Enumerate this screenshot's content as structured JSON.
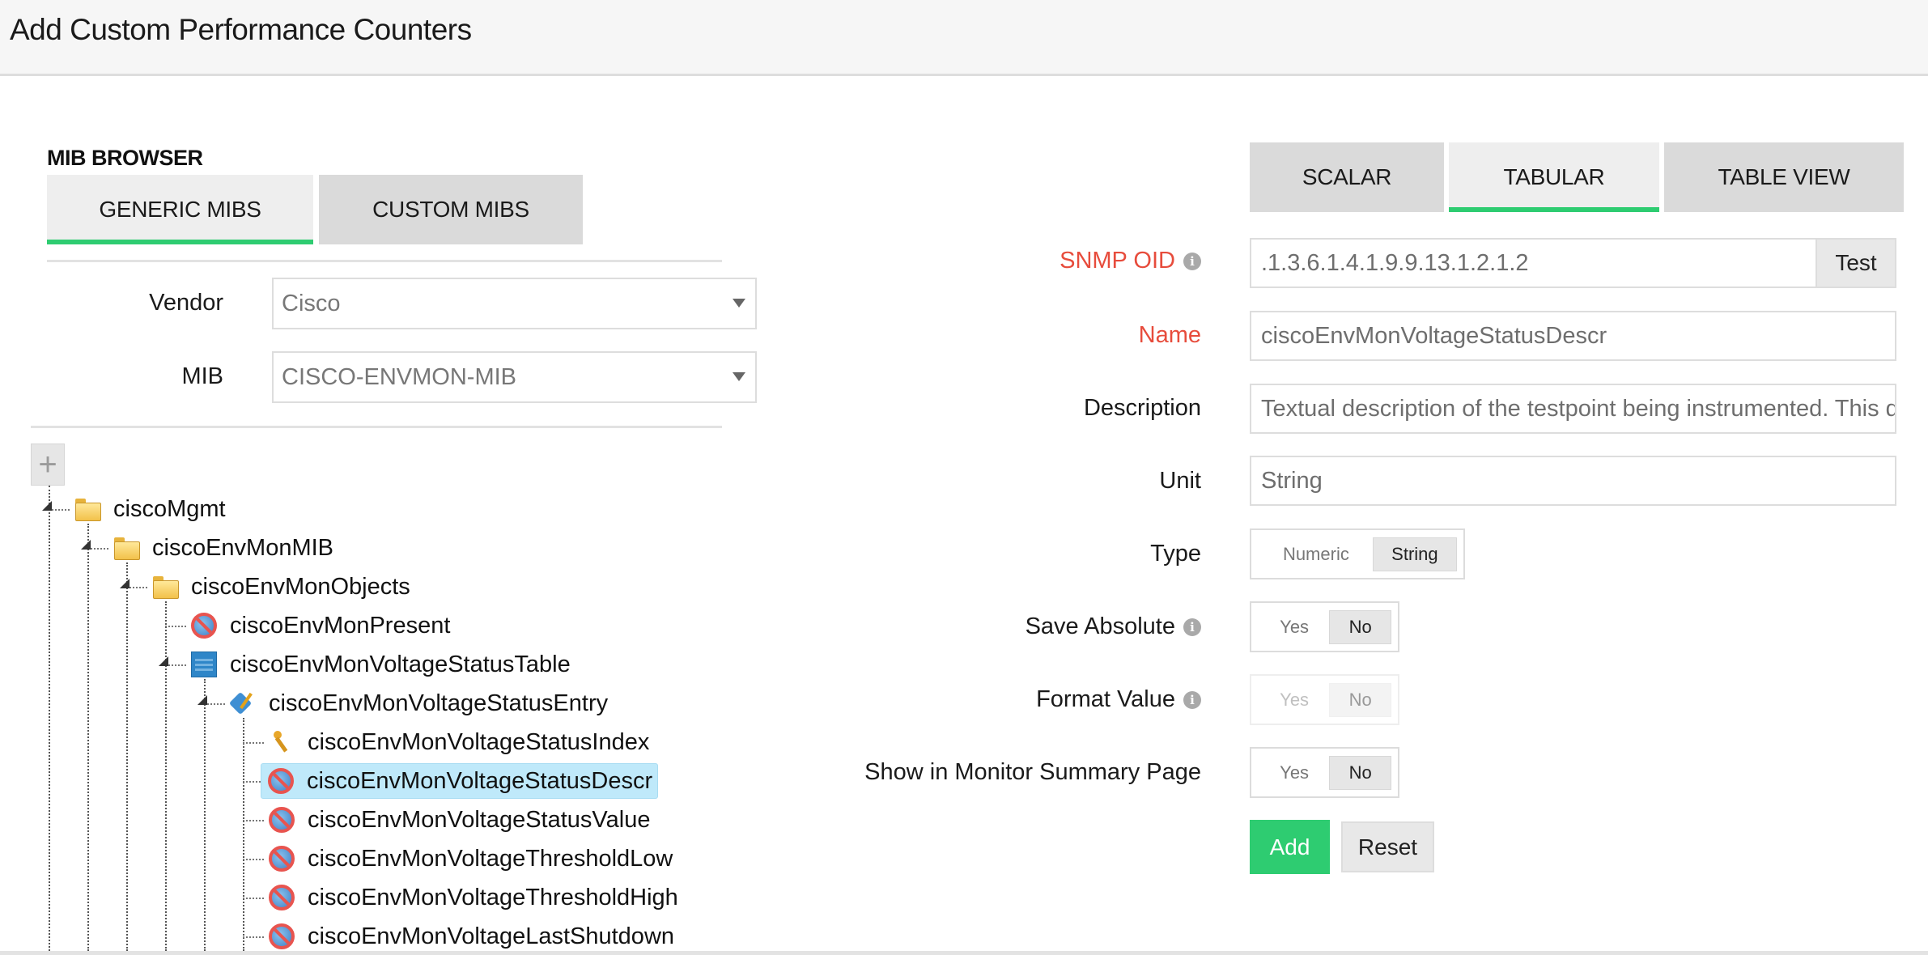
{
  "header": {
    "title": "Add Custom Performance Counters"
  },
  "mib_browser": {
    "section_label": "MIB BROWSER",
    "tabs": [
      {
        "label": "GENERIC MIBS",
        "active": true
      },
      {
        "label": "CUSTOM MIBS",
        "active": false
      }
    ],
    "vendor": {
      "label": "Vendor",
      "value": "Cisco"
    },
    "mib": {
      "label": "MIB",
      "value": "CISCO-ENVMON-MIB"
    },
    "expand_button": "+",
    "tree": [
      {
        "label": "ciscoMgmt",
        "icon": "folder-icon",
        "level": 0,
        "expanded": true
      },
      {
        "label": "ciscoEnvMonMIB",
        "icon": "folder-icon",
        "level": 1,
        "expanded": true
      },
      {
        "label": "ciscoEnvMonObjects",
        "icon": "folder-icon",
        "level": 2,
        "expanded": true
      },
      {
        "label": "ciscoEnvMonPresent",
        "icon": "no-access-icon",
        "level": 3
      },
      {
        "label": "ciscoEnvMonVoltageStatusTable",
        "icon": "table-icon",
        "level": 3,
        "expanded": true
      },
      {
        "label": "ciscoEnvMonVoltageStatusEntry",
        "icon": "table-entry-icon",
        "level": 4,
        "expanded": true
      },
      {
        "label": "ciscoEnvMonVoltageStatusIndex",
        "icon": "key-icon",
        "level": 5
      },
      {
        "label": "ciscoEnvMonVoltageStatusDescr",
        "icon": "no-access-icon",
        "level": 5,
        "selected": true
      },
      {
        "label": "ciscoEnvMonVoltageStatusValue",
        "icon": "no-access-icon",
        "level": 5
      },
      {
        "label": "ciscoEnvMonVoltageThresholdLow",
        "icon": "no-access-icon",
        "level": 5
      },
      {
        "label": "ciscoEnvMonVoltageThresholdHigh",
        "icon": "no-access-icon",
        "level": 5
      },
      {
        "label": "ciscoEnvMonVoltageLastShutdown",
        "icon": "no-access-icon",
        "level": 5
      }
    ]
  },
  "counter_form": {
    "tabs": [
      {
        "label": "SCALAR",
        "active": false
      },
      {
        "label": "TABULAR",
        "active": true
      },
      {
        "label": "TABLE VIEW",
        "active": false
      }
    ],
    "snmp_oid": {
      "label": "SNMP OID",
      "value": ".1.3.6.1.4.1.9.9.13.1.2.1.2",
      "test_label": "Test"
    },
    "name": {
      "label": "Name",
      "value": "ciscoEnvMonVoltageStatusDescr"
    },
    "description": {
      "label": "Description",
      "value": "Textual description of the testpoint being instrumented. This description is a short textual label, suitable as a human-sensible identification for the rest of the information in the entry."
    },
    "unit": {
      "label": "Unit",
      "value": "String"
    },
    "type": {
      "label": "Type",
      "options": [
        "Numeric",
        "String"
      ],
      "selected": "String"
    },
    "save_absolute": {
      "label": "Save Absolute",
      "options": [
        "Yes",
        "No"
      ],
      "selected": "No"
    },
    "format_value": {
      "label": "Format Value",
      "options": [
        "Yes",
        "No"
      ],
      "selected": "No",
      "disabled": true
    },
    "show_in_summary": {
      "label": "Show in Monitor Summary Page",
      "options": [
        "Yes",
        "No"
      ],
      "selected": "No"
    },
    "add_label": "Add",
    "reset_label": "Reset",
    "colors": {
      "accent": "#2ecc71",
      "required": "#e74c3c"
    }
  }
}
